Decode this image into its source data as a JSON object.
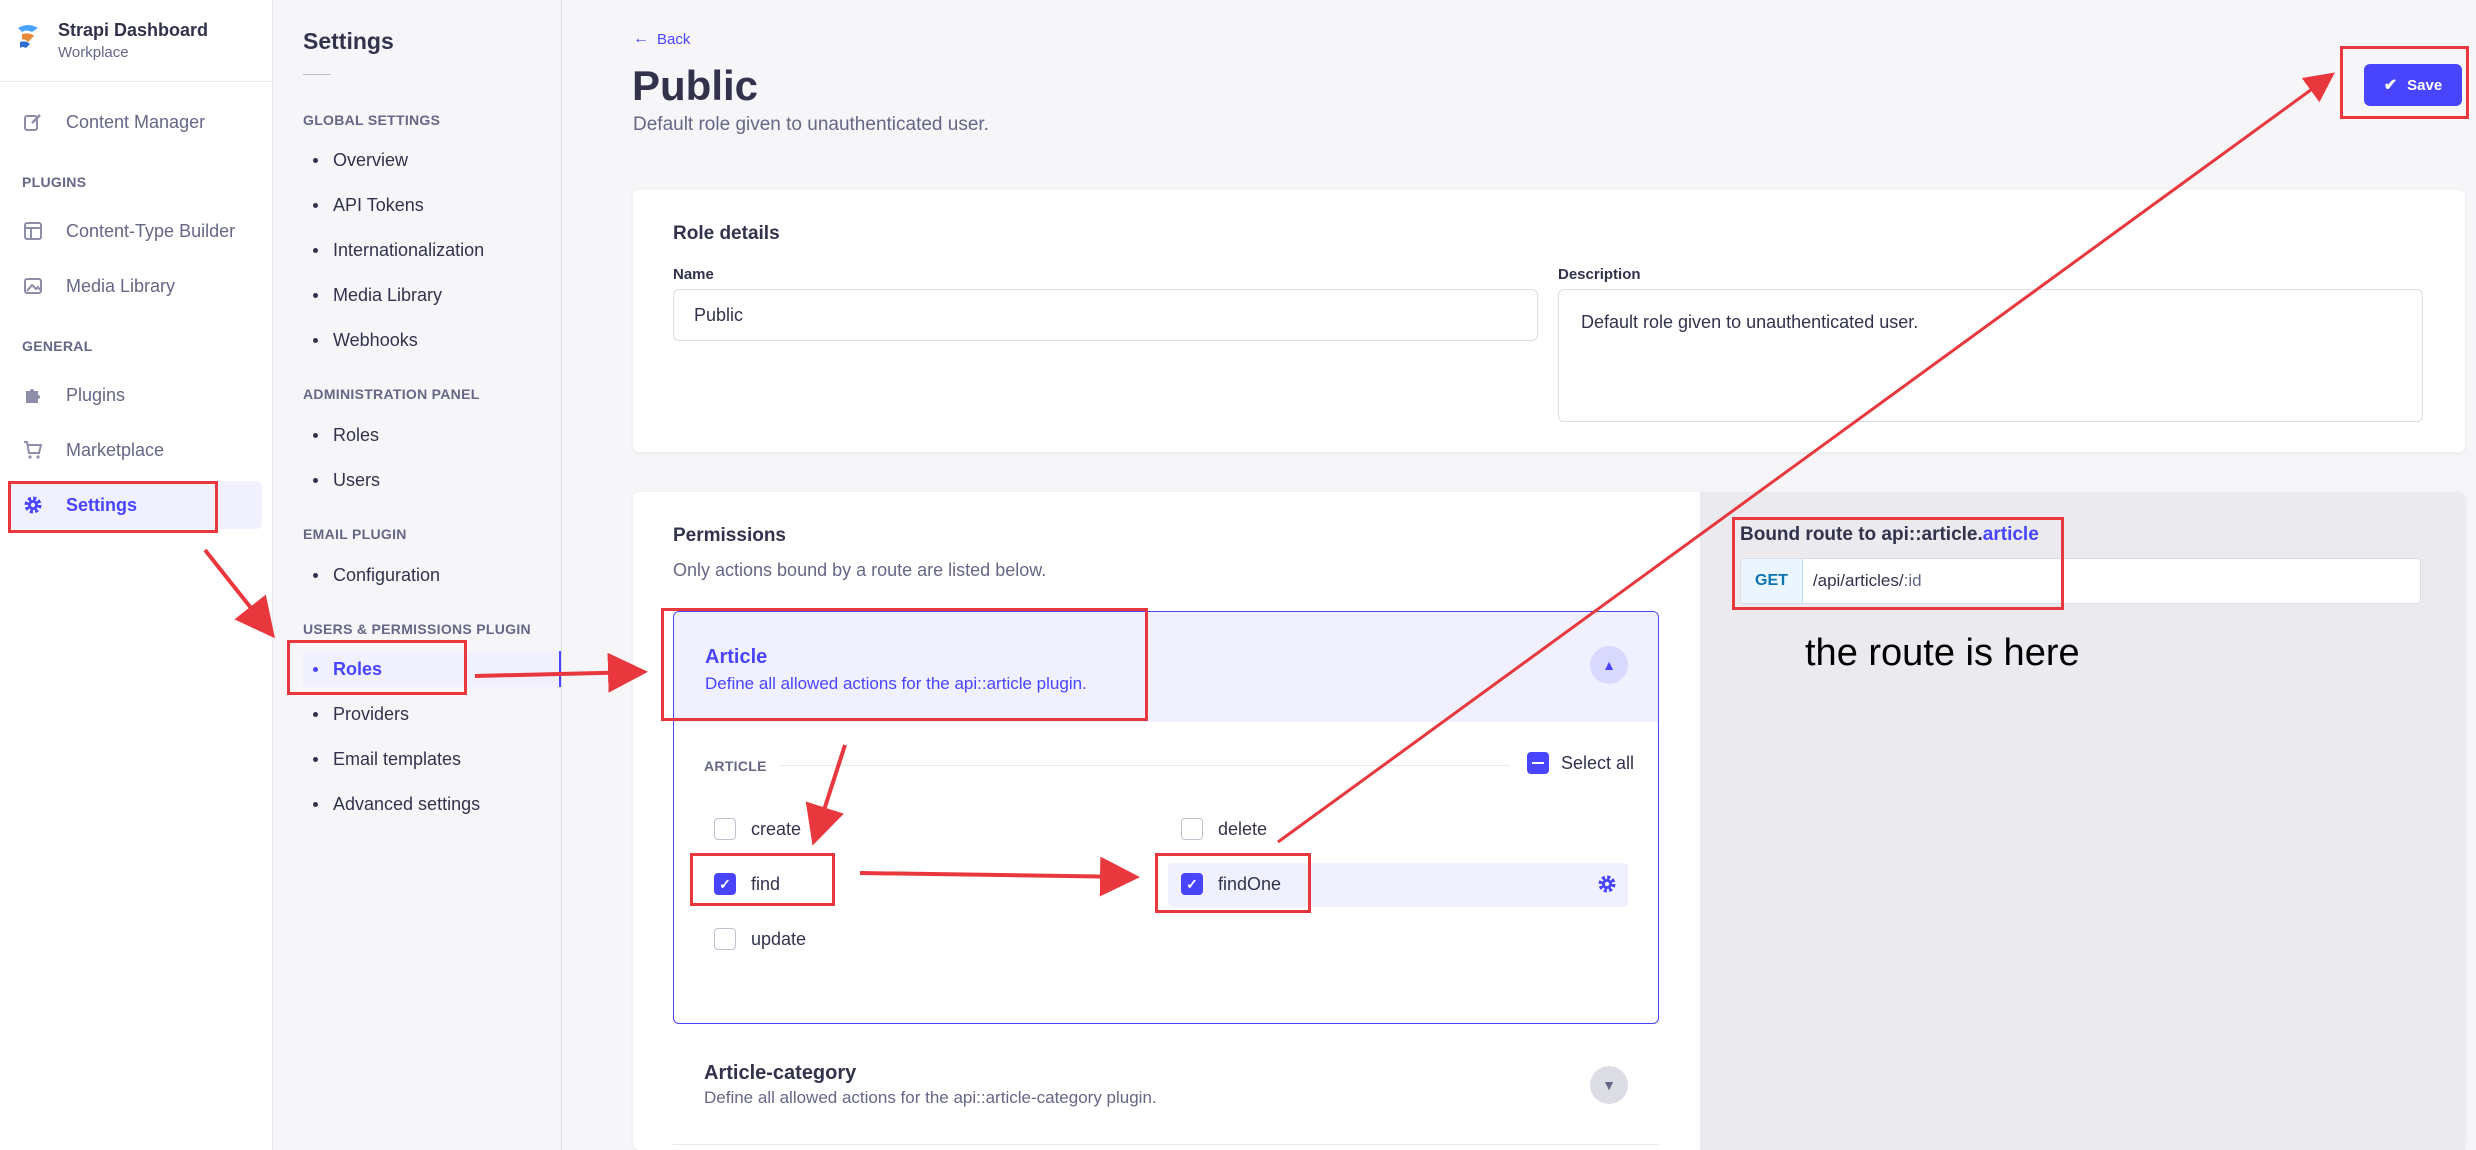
{
  "brand": {
    "title": "Strapi Dashboard",
    "subtitle": "Workplace"
  },
  "nav": {
    "content_manager": "Content Manager",
    "plugins_section": "PLUGINS",
    "content_type_builder": "Content-Type Builder",
    "media_library": "Media Library",
    "general_section": "GENERAL",
    "plugins": "Plugins",
    "marketplace": "Marketplace",
    "settings": "Settings"
  },
  "settings_nav": {
    "title": "Settings",
    "global_section": "GLOBAL SETTINGS",
    "global_items": [
      "Overview",
      "API Tokens",
      "Internationalization",
      "Media Library",
      "Webhooks"
    ],
    "admin_section": "ADMINISTRATION PANEL",
    "admin_items": [
      "Roles",
      "Users"
    ],
    "email_section": "EMAIL PLUGIN",
    "email_items": [
      "Configuration"
    ],
    "up_section": "USERS & PERMISSIONS PLUGIN",
    "up_items": [
      "Roles",
      "Providers",
      "Email templates",
      "Advanced settings"
    ]
  },
  "header": {
    "back": "Back",
    "title": "Public",
    "subtitle": "Default role given to unauthenticated user.",
    "save": "Save"
  },
  "role_details": {
    "heading": "Role details",
    "name_label": "Name",
    "name_value": "Public",
    "description_label": "Description",
    "description_value": "Default role given to unauthenticated user."
  },
  "permissions": {
    "heading": "Permissions",
    "subtitle": "Only actions bound by a route are listed below.",
    "article": {
      "title": "Article",
      "description": "Define all allowed actions for the api::article plugin.",
      "section_label": "ARTICLE",
      "select_all": "Select all",
      "actions": {
        "create": {
          "label": "create",
          "checked": false
        },
        "delete": {
          "label": "delete",
          "checked": false
        },
        "find": {
          "label": "find",
          "checked": true
        },
        "findOne": {
          "label": "findOne",
          "checked": true
        },
        "update": {
          "label": "update",
          "checked": false
        }
      }
    },
    "article_category": {
      "title": "Article-category",
      "description": "Define all allowed actions for the api::article-category plugin."
    }
  },
  "bound_route": {
    "title_prefix": "Bound route to api::article.",
    "title_highlight": "article",
    "method": "GET",
    "path_main": "/api/articles/",
    "path_param": ":id",
    "annotation": "the route is here"
  },
  "colors": {
    "primary": "#4945ff",
    "primary_light": "#f0f0ff",
    "annotation_red": "#e8383d",
    "text": "#32324d",
    "muted": "#666687"
  }
}
